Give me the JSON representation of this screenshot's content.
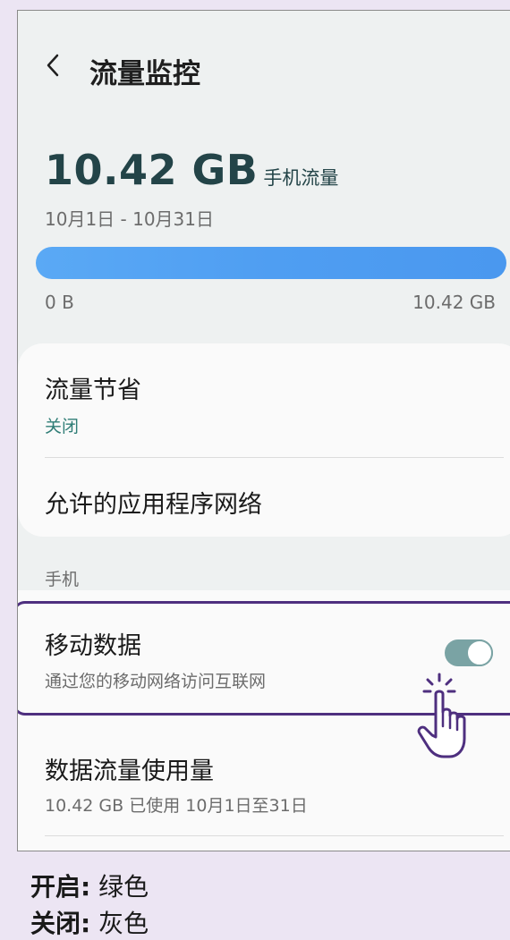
{
  "header": {
    "back_icon": "chevron-left-icon",
    "title": "流量监控"
  },
  "usage": {
    "amount": "10.42 GB",
    "unit_label": "手机流量",
    "period": "10月1日 - 10月31日",
    "bar_fraction": 1.0,
    "bar_min_label": "0 B",
    "bar_max_label": "10.42 GB"
  },
  "settings": {
    "data_saver": {
      "title": "流量节省",
      "status": "关闭"
    },
    "allowed_apps": {
      "title": "允许的应用程序网络"
    }
  },
  "mobile_section": {
    "label": "手机",
    "mobile_data": {
      "title": "移动数据",
      "subtitle": "通过您的移动网络访问互联网",
      "toggle_on": true
    },
    "usage": {
      "title": "数据流量使用量",
      "subtitle": "10.42 GB 已使用 10月1日至31日"
    }
  },
  "legend": {
    "on_label": "开启:",
    "on_value": "绿色",
    "off_label": "关闭:",
    "off_value": "灰色"
  },
  "colors": {
    "accent_bar": "#4f9ef2",
    "toggle_on": "#7aa3a4",
    "highlight_border": "#4e2f7f",
    "status_off": "#2f7d76"
  }
}
